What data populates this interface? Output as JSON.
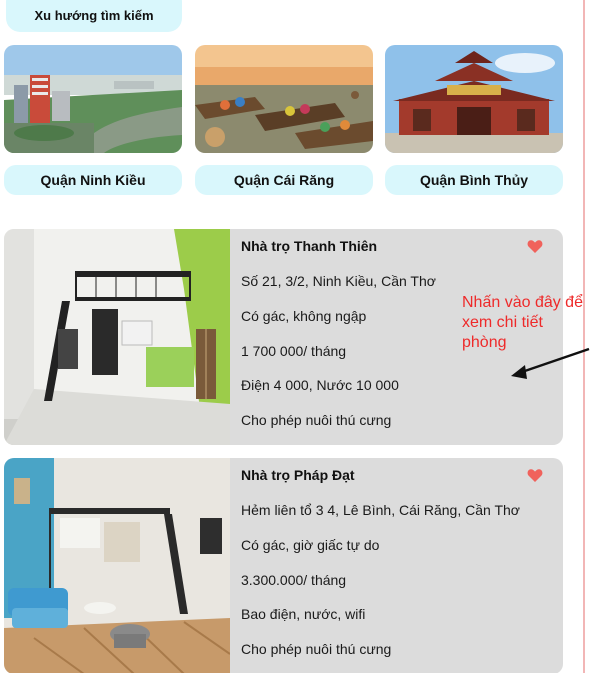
{
  "trend": {
    "label": "Xu hướng tìm kiếm"
  },
  "districts": [
    {
      "name": "Quận Ninh Kiều"
    },
    {
      "name": "Quận Cái Răng"
    },
    {
      "name": "Quận Bình Thủy"
    }
  ],
  "listings": [
    {
      "title": "Nhà trọ Thanh Thiên",
      "address": "Số 21, 3/2, Ninh Kiều, Cần Thơ",
      "features": "Có gác, không ngập",
      "price": "1 700 000/ tháng",
      "utilities": "Điện 4 000, Nước 10 000",
      "pets": "Cho phép nuôi thú cưng"
    },
    {
      "title": "Nhà trọ Pháp Đạt",
      "address": "Hẻm liên tổ 3 4, Lê Bình, Cái Răng, Cần Thơ",
      "features": "Có gác, giờ giấc tự do",
      "price": "3.300.000/ tháng",
      "utilities": "Bao điện, nước, wifi",
      "pets": "Cho phép nuôi thú cưng"
    }
  ],
  "annotation": {
    "text": "Nhấn vào đây để xem chi tiết phòng"
  },
  "colors": {
    "chip": "#d9f7fc",
    "card": "#dcdcdc",
    "heart": "#f0625c",
    "annotation": "#ee2a2a"
  }
}
